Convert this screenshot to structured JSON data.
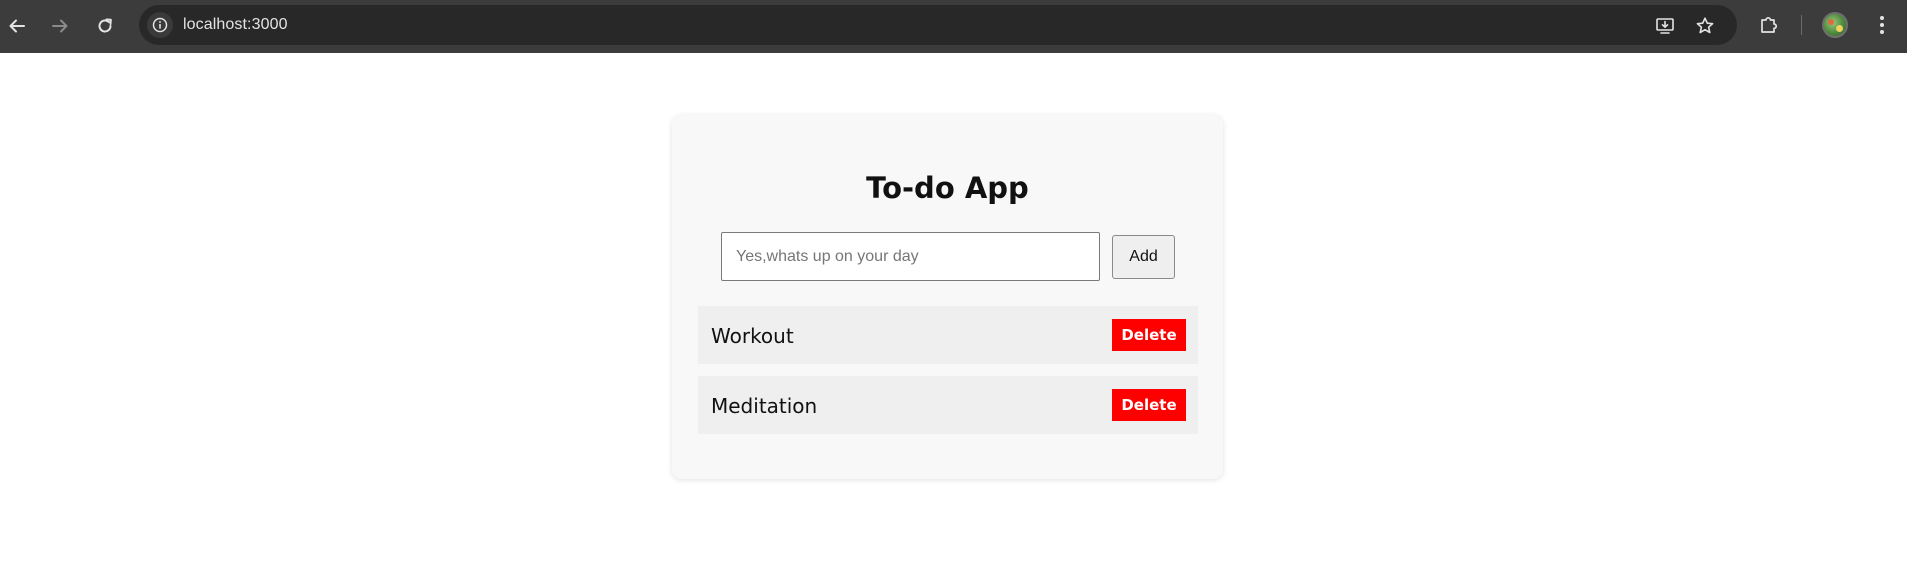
{
  "browser": {
    "url": "localhost:3000",
    "icons": {
      "back": "arrow-left-icon",
      "forward": "arrow-right-icon",
      "reload": "reload-icon",
      "site_info": "info-icon",
      "install": "install-app-icon",
      "bookmark": "star-icon",
      "extensions": "puzzle-piece-icon",
      "menu": "kebab-menu-icon"
    }
  },
  "app": {
    "title": "To-do App",
    "input": {
      "value": "",
      "placeholder": "Yes,whats up on your day"
    },
    "add_label": "Add",
    "todos": [
      {
        "text": "Workout",
        "delete_label": "Delete"
      },
      {
        "text": "Meditation",
        "delete_label": "Delete"
      }
    ]
  },
  "colors": {
    "delete_button": "#ff0000",
    "card_background": "#f8f8f8",
    "item_background": "#efefef",
    "browser_bar": "#3c3c3c"
  }
}
